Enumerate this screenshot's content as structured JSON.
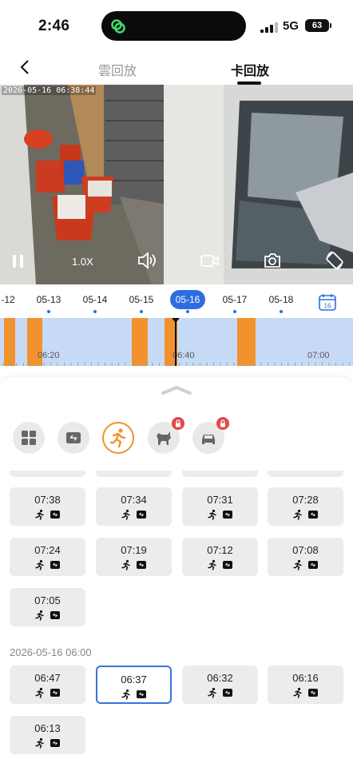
{
  "status": {
    "time": "2:46",
    "network": "5G",
    "battery": "63"
  },
  "nav": {
    "tabs": [
      "雲回放",
      "卡回放"
    ],
    "active_tab": "卡回放"
  },
  "video": {
    "osd_timestamp": "2026-05-16 06:38:44",
    "speed": "1.0X"
  },
  "dates": {
    "items": [
      "-12",
      "05-13",
      "05-14",
      "05-15",
      "05-16",
      "05-17",
      "05-18"
    ],
    "selected": "05-16",
    "calendar_day": "16"
  },
  "timeline": {
    "labels": [
      "06:20",
      "06:40",
      "07:00"
    ],
    "colors": {
      "event": "#f2922e",
      "track": "#c6daf5"
    }
  },
  "filters": [
    "all-events",
    "screen-change",
    "motion",
    "pet",
    "vehicle"
  ],
  "events": {
    "rows_top": [
      [
        "07:38",
        "07:34",
        "07:31",
        "07:28"
      ],
      [
        "07:24",
        "07:19",
        "07:12",
        "07:08"
      ],
      [
        "07:05"
      ]
    ],
    "group_label": "2026-05-16 06:00",
    "rows_bottom": [
      [
        "06:47",
        "06:37",
        "06:32",
        "06:16"
      ],
      [
        "06:13"
      ]
    ],
    "selected": "06:37"
  },
  "colors": {
    "accent": "#f2922e",
    "selected_border": "#3b72d9",
    "date_selected": "#2d6de0",
    "lock": "#e04b4b"
  }
}
